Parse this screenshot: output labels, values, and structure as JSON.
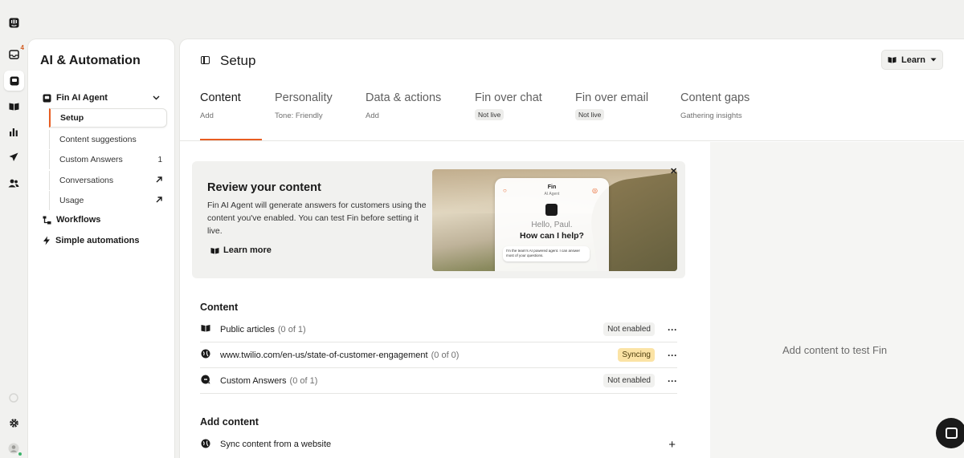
{
  "rail": {
    "inbox_badge": "4"
  },
  "nav": {
    "title": "AI & Automation",
    "group_label": "Fin AI Agent",
    "sub_items": [
      {
        "label": "Setup"
      },
      {
        "label": "Content suggestions"
      },
      {
        "label": "Custom Answers",
        "count": "1"
      },
      {
        "label": "Conversations"
      },
      {
        "label": "Usage"
      }
    ],
    "workflows_label": "Workflows",
    "simple_automations_label": "Simple automations"
  },
  "header": {
    "title": "Setup",
    "learn_label": "Learn"
  },
  "tabs": [
    {
      "label": "Content",
      "sub": "Add"
    },
    {
      "label": "Personality",
      "sub": "Tone: Friendly"
    },
    {
      "label": "Data & actions",
      "sub": "Add"
    },
    {
      "label": "Fin over chat",
      "pill": "Not live"
    },
    {
      "label": "Fin over email",
      "pill": "Not live"
    },
    {
      "label": "Content gaps",
      "sub": "Gathering insights"
    }
  ],
  "review": {
    "title": "Review your content",
    "text": "Fin AI Agent will generate answers for customers using the content you've enabled. You can test Fin before setting it live.",
    "link": "Learn more",
    "preview": {
      "name": "Fin",
      "sub": "AI Agent",
      "hello": "Hello, Paul.",
      "help": "How can I help?",
      "message": "I'm the team's AI powered agent. I can answer most of your questions."
    }
  },
  "content": {
    "title": "Content",
    "rows": [
      {
        "label": "Public articles",
        "count": "(0 of 1)",
        "status": "Not enabled"
      },
      {
        "label": "www.twilio.com/en-us/state-of-customer-engagement",
        "count": "(0 of 0)",
        "status": "Syncing"
      },
      {
        "label": "Custom Answers",
        "count": "(0 of 1)",
        "status": "Not enabled"
      }
    ]
  },
  "add_content": {
    "title": "Add content",
    "rows": [
      {
        "label": "Sync content from a website"
      }
    ]
  },
  "right_pane": {
    "text": "Add content to test Fin"
  },
  "colors": {
    "accent": "#e85d21",
    "syncing_bg": "#fbe3a5"
  }
}
